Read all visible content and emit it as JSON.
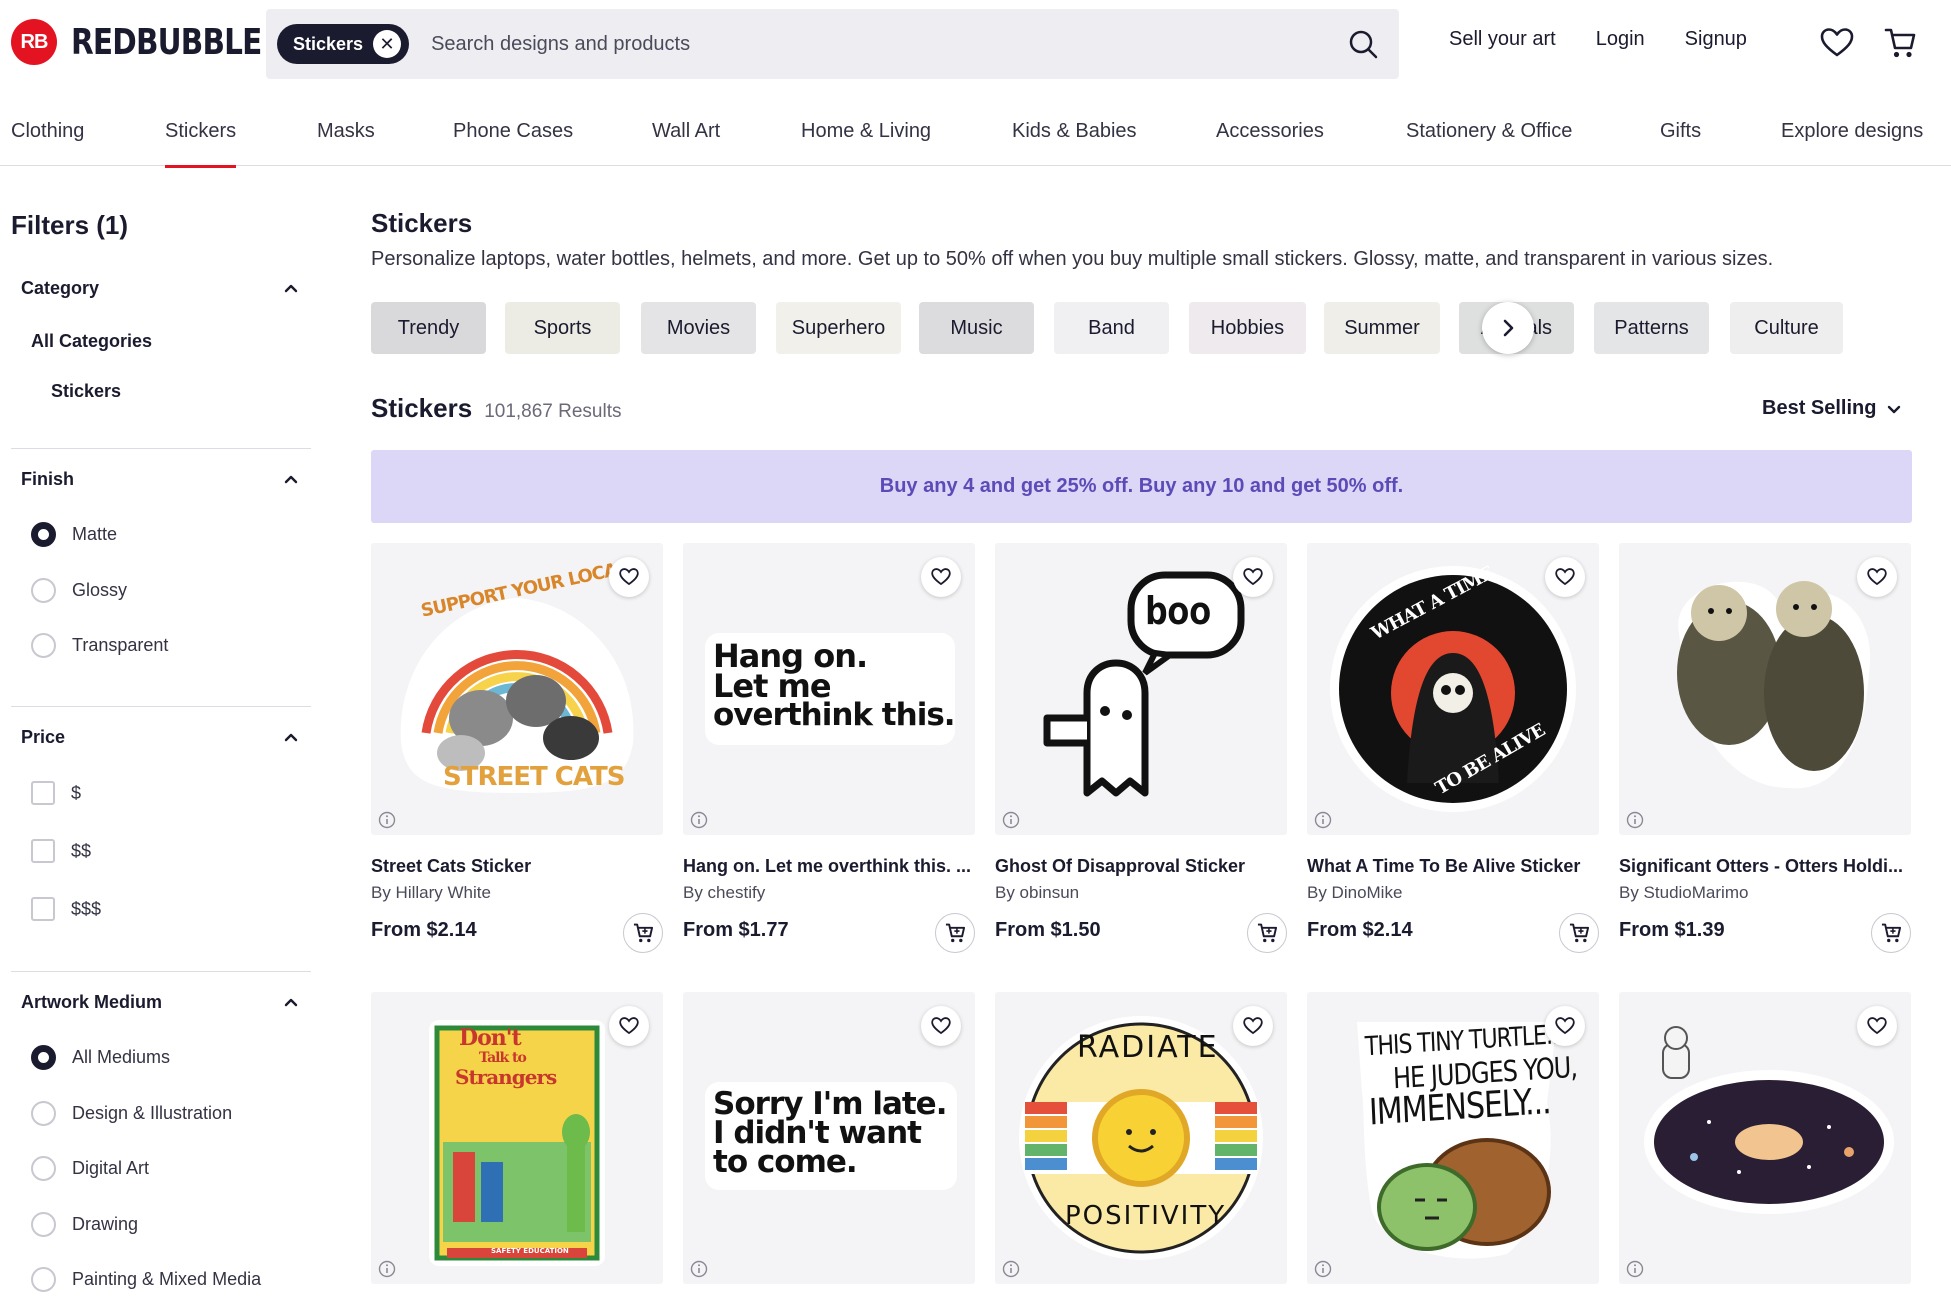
{
  "brand": {
    "name": "REDBUBBLE",
    "mark": "RB"
  },
  "search": {
    "chip_label": "Stickers",
    "placeholder": "Search designs and products"
  },
  "header_links": [
    "Sell your art",
    "Login",
    "Signup"
  ],
  "category_nav": [
    "Clothing",
    "Stickers",
    "Masks",
    "Phone Cases",
    "Wall Art",
    "Home & Living",
    "Kids & Babies",
    "Accessories",
    "Stationery & Office",
    "Gifts",
    "Explore designs"
  ],
  "active_category": "Stickers",
  "sidebar": {
    "filters_title": "Filters (1)",
    "category": {
      "title": "Category",
      "items": [
        "All Categories",
        "Stickers"
      ]
    },
    "finish": {
      "title": "Finish",
      "options": [
        "Matte",
        "Glossy",
        "Transparent"
      ],
      "selected": "Matte"
    },
    "price": {
      "title": "Price",
      "options": [
        "$",
        "$$",
        "$$$"
      ]
    },
    "medium": {
      "title": "Artwork Medium",
      "options": [
        "All Mediums",
        "Design & Illustration",
        "Digital Art",
        "Drawing",
        "Painting & Mixed Media"
      ],
      "selected": "All Mediums"
    }
  },
  "main": {
    "title": "Stickers",
    "description": "Personalize laptops, water bottles, helmets, and more. Get up to 50% off when you buy multiple small stickers. Glossy, matte, and transparent in various sizes.",
    "tags": [
      {
        "label": "Trendy",
        "color": "#d9d9dc"
      },
      {
        "label": "Sports",
        "color": "#ecebe4"
      },
      {
        "label": "Movies",
        "color": "#e4e4e6"
      },
      {
        "label": "Superhero",
        "color": "#f2f0ea"
      },
      {
        "label": "Music",
        "color": "#dcdcdf"
      },
      {
        "label": "Band",
        "color": "#f0f0f2"
      },
      {
        "label": "Hobbies",
        "color": "#efeaee"
      },
      {
        "label": "Summer",
        "color": "#efeee9"
      },
      {
        "label": "Animals",
        "color": "#dde0de"
      },
      {
        "label": "Patterns",
        "color": "#e3e5e7"
      },
      {
        "label": "Culture",
        "color": "#eeeeee"
      }
    ],
    "results_title": "Stickers",
    "results_count": "101,867 Results",
    "sort_label": "Best Selling",
    "promo": "Buy any 4 and get 25% off.  Buy any 10 and get 50% off."
  },
  "products": [
    {
      "title": "Street Cats Sticker",
      "artist": "By Hillary White",
      "price": "From $2.14",
      "art_text": [
        "SUPPORT YOUR LOCAL",
        "STREET CATS"
      ]
    },
    {
      "title": "Hang on. Let me overthink this. ...",
      "artist": "By chestify",
      "price": "From $1.77",
      "art_text": [
        "Hang on.",
        "Let me",
        "overthink this."
      ]
    },
    {
      "title": "Ghost Of Disapproval Sticker",
      "artist": "By obinsun",
      "price": "From $1.50",
      "art_text": [
        "boo"
      ]
    },
    {
      "title": "What A Time To Be Alive Sticker",
      "artist": "By DinoMike",
      "price": "From $2.14",
      "art_text": [
        "WHAT A TIME",
        "TO BE ALIVE"
      ]
    },
    {
      "title": "Significant Otters - Otters Holdi...",
      "artist": "By StudioMarimo",
      "price": "From $1.39",
      "art_text": []
    },
    {
      "title": "",
      "artist": "",
      "price": "",
      "art_text": [
        "Don't",
        "Talk to",
        "Strangers",
        "SAFETY EDUCATION"
      ]
    },
    {
      "title": "",
      "artist": "",
      "price": "",
      "art_text": [
        "Sorry I'm late.",
        "I didn't want",
        "to come."
      ]
    },
    {
      "title": "",
      "artist": "",
      "price": "",
      "art_text": [
        "RADIATE",
        "POSITIVITY"
      ]
    },
    {
      "title": "",
      "artist": "",
      "price": "",
      "art_text": [
        "THIS TINY TURTLE...",
        "HE JUDGES YOU,",
        "IMMENSELY..."
      ]
    },
    {
      "title": "",
      "artist": "",
      "price": "",
      "art_text": []
    }
  ],
  "colors": {
    "brand_red": "#e41321",
    "navy": "#1b1b2f",
    "promo_bg": "#dcd6f7",
    "promo_text": "#5b4bb7"
  }
}
